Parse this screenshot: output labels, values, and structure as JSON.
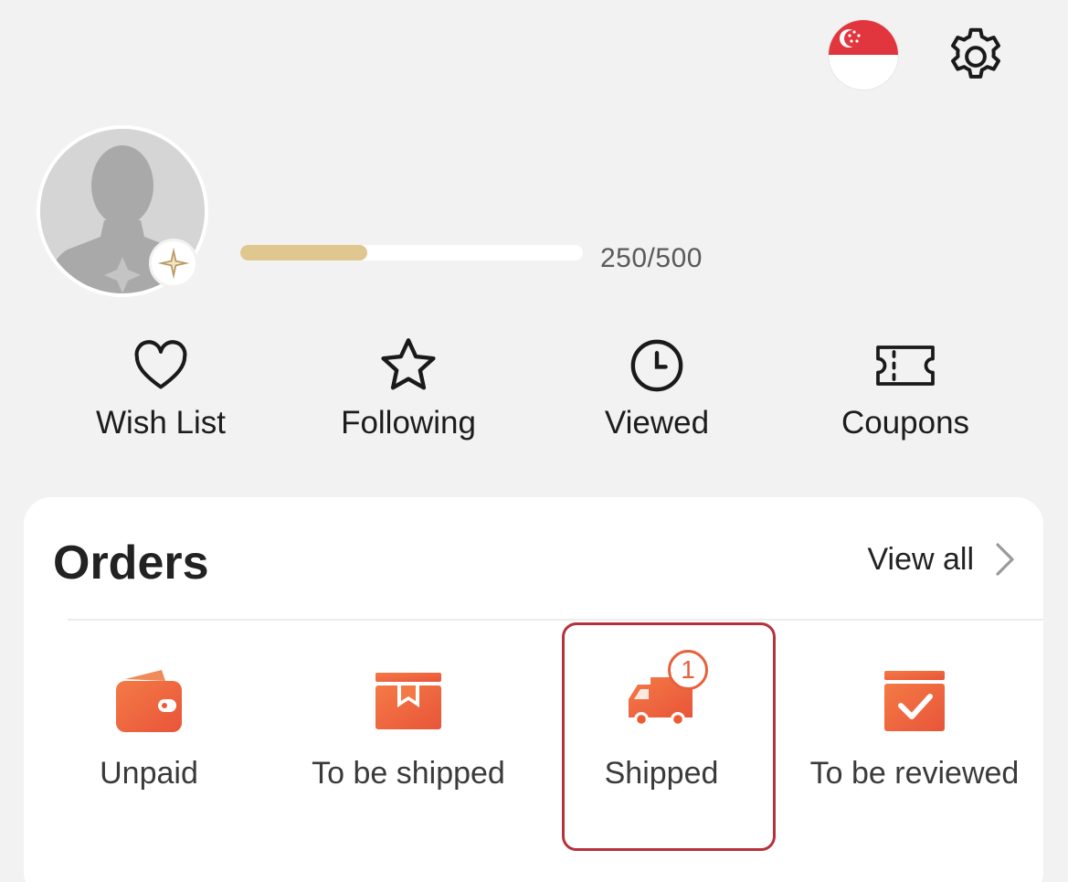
{
  "header": {
    "flag_icon": "singapore-flag-icon",
    "settings_icon": "gear-icon"
  },
  "profile": {
    "avatar_icon": "default-avatar-icon",
    "level_badge_icon": "sparkle-star-icon",
    "progress_text": "250/500",
    "progress_fraction": 0.37,
    "progress_color": "#e0c68f"
  },
  "quick_actions": [
    {
      "label": "Wish List",
      "icon": "heart-icon"
    },
    {
      "label": "Following",
      "icon": "star-icon"
    },
    {
      "label": "Viewed",
      "icon": "clock-icon"
    },
    {
      "label": "Coupons",
      "icon": "ticket-icon"
    }
  ],
  "orders": {
    "title": "Orders",
    "view_all_label": "View all",
    "view_all_icon": "chevron-right-icon",
    "accent_color": "#ee5b33",
    "items": [
      {
        "label": "Unpaid",
        "icon": "wallet-icon"
      },
      {
        "label": "To be shipped",
        "icon": "box-icon"
      },
      {
        "label": "Shipped",
        "icon": "truck-icon",
        "badge": "1"
      },
      {
        "label": "To be reviewed",
        "icon": "review-check-icon"
      }
    ]
  }
}
